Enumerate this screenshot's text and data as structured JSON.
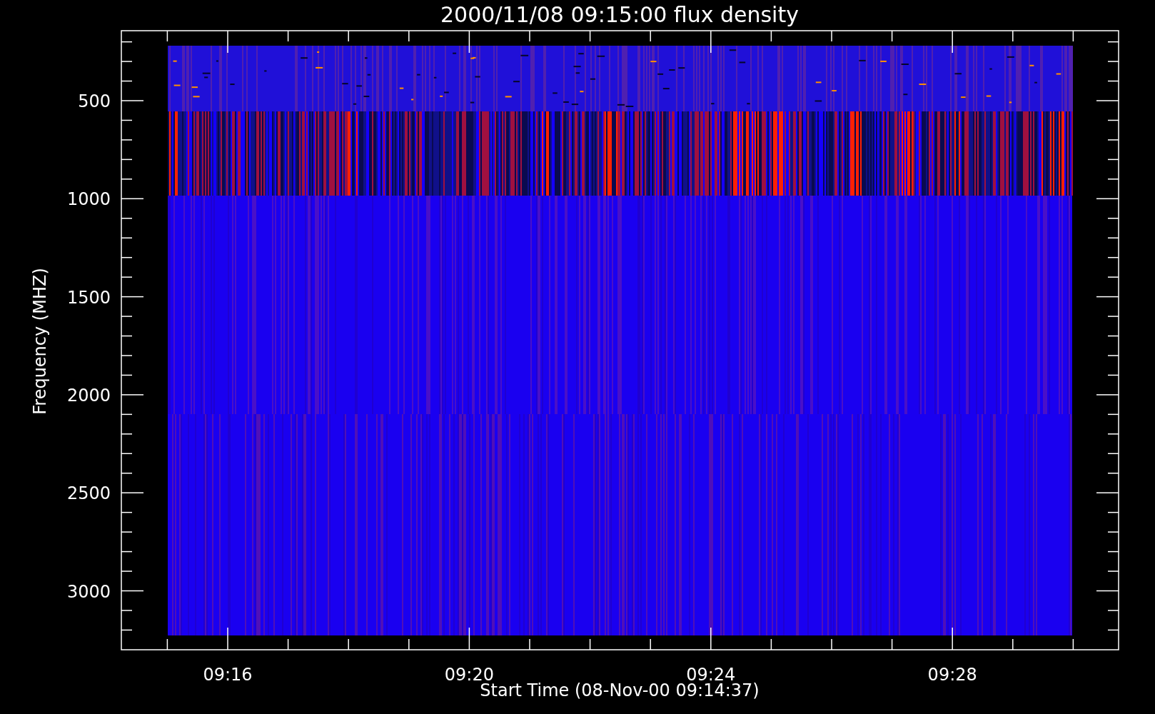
{
  "plot": {
    "title": "2000/11/08 09:15:00 flux density",
    "xlabel": "Start Time (08-Nov-00 09:14:37)",
    "ylabel": "Frequency (MHZ)",
    "xtick_labels": [
      "09:16",
      "09:20",
      "09:24",
      "09:28"
    ],
    "ytick_labels": [
      "500",
      "1000",
      "1500",
      "2000",
      "2500",
      "3000"
    ]
  }
}
